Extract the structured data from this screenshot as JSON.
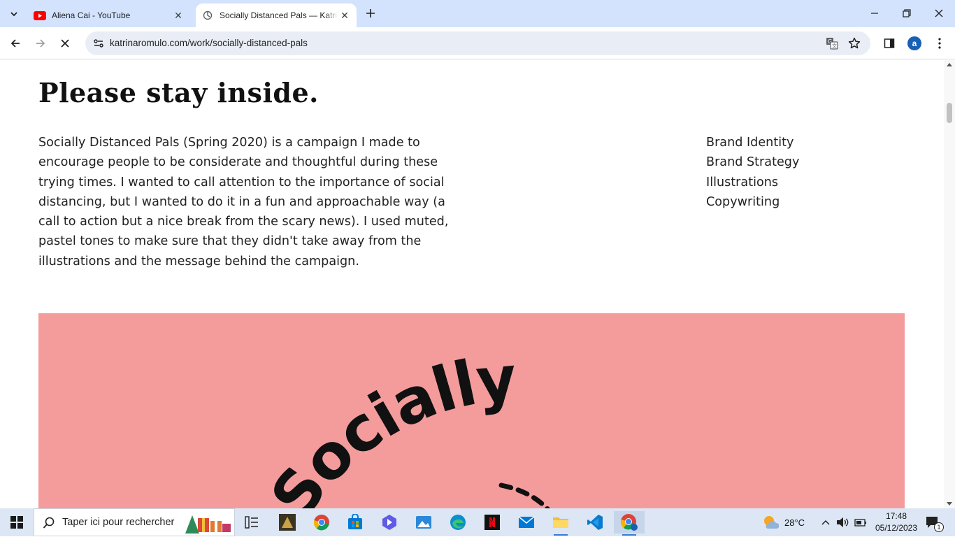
{
  "browser": {
    "tabs": [
      {
        "title": "Aliena Cai - YouTube",
        "favicon": "youtube-icon",
        "active": false
      },
      {
        "title": "Socially Distanced Pals — Katrina Romulo",
        "favicon": "globe-icon",
        "active": true
      }
    ],
    "url": "katrinaromulo.com/work/socially-distanced-pals",
    "avatar_letter": "a"
  },
  "page": {
    "heading": "Please stay inside.",
    "description": "Socially Distanced Pals (Spring 2020) is a campaign I made to encourage people to be considerate and thoughtful during these trying times. I wanted to call attention to the importance of social distancing, but I wanted to do it in a fun and approachable way (a call to action but a nice break from the scary news). I used muted, pastel tones to make sure that they didn't take away from the illustrations and the message behind the campaign.",
    "services": [
      "Brand Identity",
      "Brand Strategy",
      "Illustrations",
      "Copywriting"
    ],
    "hero_text": "Socially",
    "hero_bg": "#f49c9c"
  },
  "taskbar": {
    "search_placeholder": "Taper ici pour rechercher",
    "weather": "28°C",
    "time": "17:48",
    "date": "05/12/2023",
    "notification_count": "1"
  }
}
